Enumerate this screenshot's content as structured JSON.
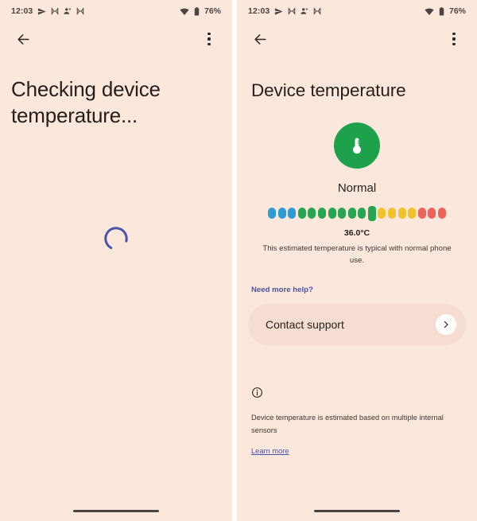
{
  "status_bar": {
    "time": "12:03",
    "battery_percent": "76%",
    "icons": [
      "send-arrow-icon",
      "app-badge-icon",
      "person-add-icon",
      "app-badge-icon",
      "wifi-icon",
      "battery-icon"
    ]
  },
  "app_bar": {
    "back_label": "back-arrow-icon",
    "overflow_label": "more-options-icon"
  },
  "left_screen": {
    "headline": "Checking device temperature...",
    "spinner_color": "#4a53a8"
  },
  "right_screen": {
    "headline": "Device temperature",
    "thermometer_circle_color": "#1ea14b",
    "status_word": "Normal",
    "temperature_value": "36.0°C",
    "description": "This estimated temperature is typical with normal phone use.",
    "need_more_help": "Need more help?",
    "contact_support": "Contact support",
    "info_text": "Device temperature is estimated based on multiple internal sensors",
    "learn_more": "Learn more",
    "scale": {
      "dots": [
        {
          "color": "#2f9ad4",
          "marker": false
        },
        {
          "color": "#2f9ad4",
          "marker": false
        },
        {
          "color": "#2f9ad4",
          "marker": false
        },
        {
          "color": "#27a550",
          "marker": false
        },
        {
          "color": "#27a550",
          "marker": false
        },
        {
          "color": "#27a550",
          "marker": false
        },
        {
          "color": "#27a550",
          "marker": false
        },
        {
          "color": "#27a550",
          "marker": false
        },
        {
          "color": "#27a550",
          "marker": false
        },
        {
          "color": "#27a550",
          "marker": false
        },
        {
          "color": "#27a550",
          "marker": true
        },
        {
          "color": "#f2c12e",
          "marker": false
        },
        {
          "color": "#f2c12e",
          "marker": false
        },
        {
          "color": "#f2c12e",
          "marker": false
        },
        {
          "color": "#f2c12e",
          "marker": false
        },
        {
          "color": "#ec6459",
          "marker": false
        },
        {
          "color": "#ec6459",
          "marker": false
        },
        {
          "color": "#ec6459",
          "marker": false
        }
      ]
    }
  },
  "theme": {
    "background": "#fbe7dc",
    "card_background": "#f6ddd1",
    "link_color": "#4a53a8",
    "text_primary": "#241f1c"
  }
}
